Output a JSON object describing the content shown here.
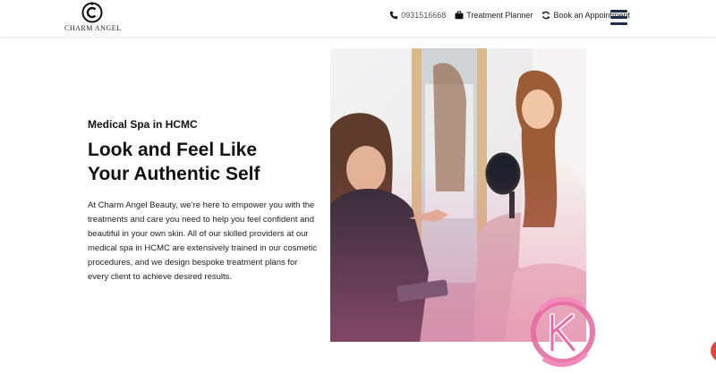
{
  "header": {
    "logo_text": "CHARM ANGEL",
    "phone": "0931516668",
    "treatment_planner": "Treatment Planner",
    "book_appointment": "Book an Appointment"
  },
  "main": {
    "eyebrow": "Medical Spa in HCMC",
    "headline_line1": "Look and Feel Like",
    "headline_line2": "Your Authentic Self",
    "body": "At Charm Angel Beauty, we’re here to empower you with the treatments and care you need to help you feel confident and beautiful in your own skin. All of our skilled providers at our medical spa in HCMC are extensively trained in our cosmetic procedures, and we design bespoke treatment plans for every client to achieve desired results."
  },
  "icons": {
    "phone": "phone-icon",
    "planner": "briefcase-icon",
    "booking": "refresh-icon",
    "menu": "hamburger-menu-icon"
  },
  "colors": {
    "menu_navy": "#1f2d4d",
    "brand_pink": "#e86aa3",
    "chat_red": "#d94a3b"
  }
}
